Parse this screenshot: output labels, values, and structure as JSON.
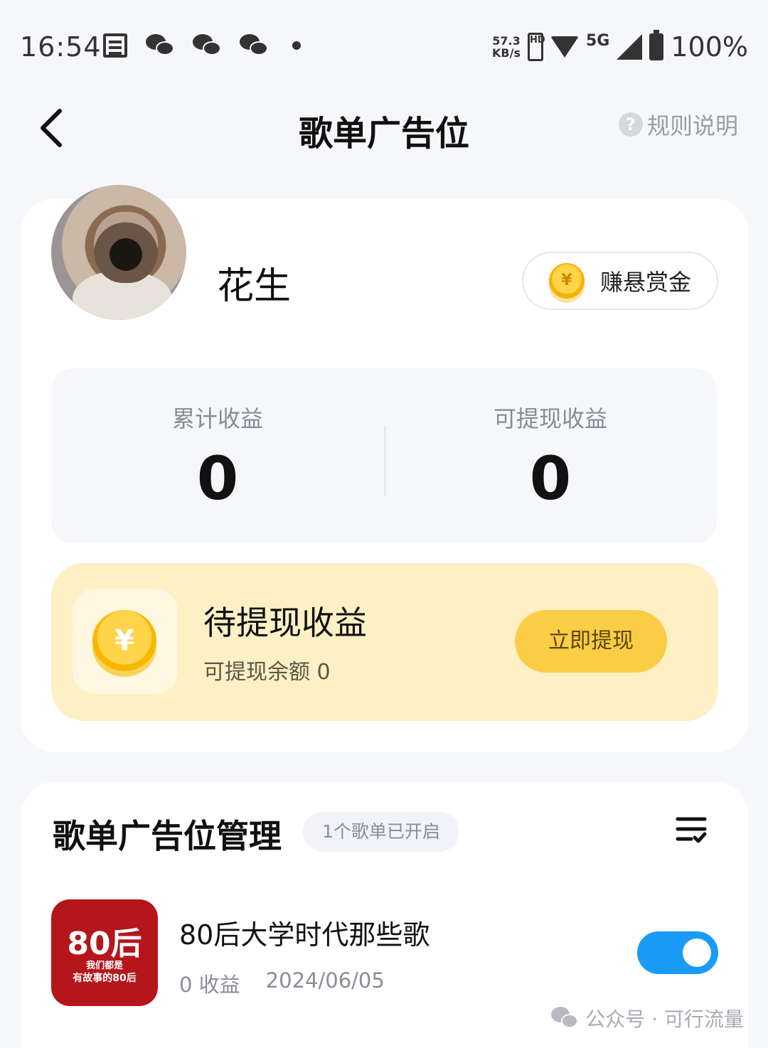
{
  "status_bar": {
    "time": "16:54",
    "net_speed_value": "57.3",
    "net_speed_unit": "KB/s",
    "hd_label": "HD",
    "network": "5G",
    "battery": "100%"
  },
  "nav": {
    "title": "歌单广告位",
    "help_label": "规则说明",
    "help_symbol": "?"
  },
  "profile": {
    "name": "花生",
    "bounty_button": "赚悬赏金",
    "coin_symbol": "¥"
  },
  "stats": {
    "total_label": "累计收益",
    "total_value": "0",
    "withdrawable_label": "可提现收益",
    "withdrawable_value": "0"
  },
  "withdraw": {
    "title": "待提现收益",
    "balance_text": "可提现余额 0",
    "button": "立即提现",
    "coin_symbol": "¥"
  },
  "management": {
    "title": "歌单广告位管理",
    "badge": "1个歌单已开启",
    "playlists": [
      {
        "name": "80后大学时代那些歌",
        "earnings": "0 收益",
        "date": "2024/06/05",
        "cover_title": "80后",
        "cover_line1": "我们都是",
        "cover_line2": "有故事的80后",
        "enabled": true
      }
    ]
  },
  "watermark": {
    "text": "公众号 · 可行流量"
  },
  "colors": {
    "accent_yellow": "#fbcd45",
    "toggle_blue": "#1a9bf5",
    "cover_red": "#b5161b"
  }
}
